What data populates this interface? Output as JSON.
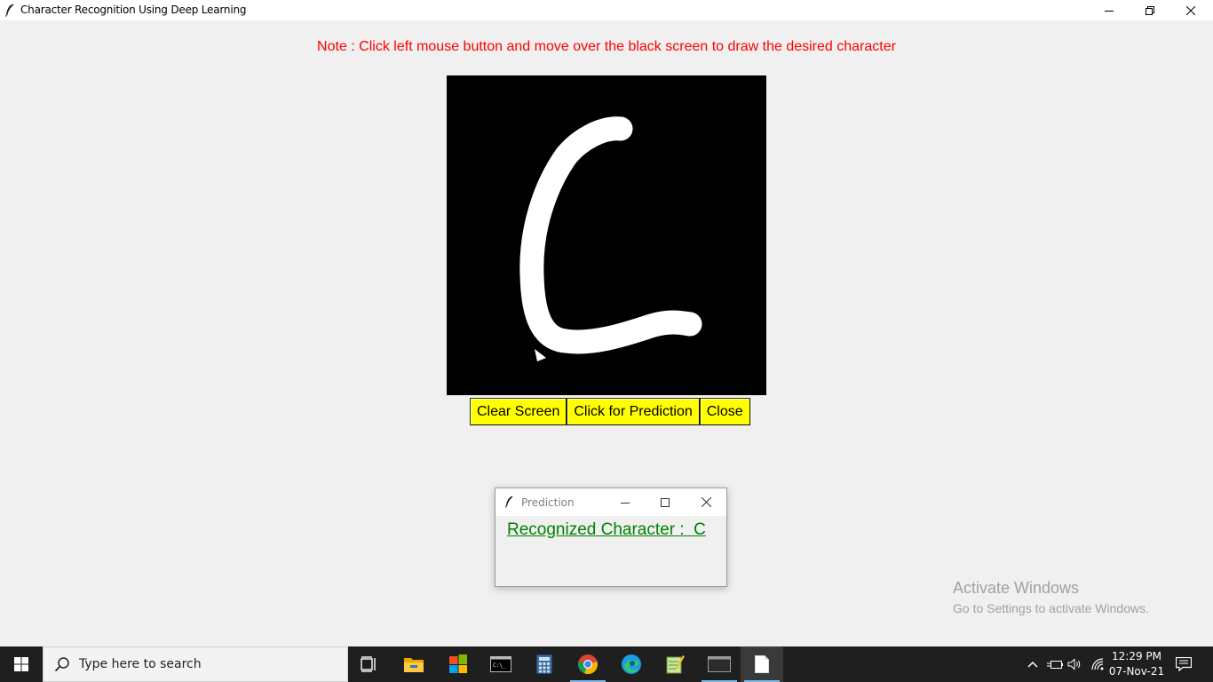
{
  "window": {
    "title": "Character Recognition Using Deep Learning"
  },
  "note": "Note : Click left mouse button and move over the black screen to draw the desired character",
  "buttons": {
    "clear": "Clear Screen",
    "predict": "Click for Prediction",
    "close": "Close"
  },
  "prediction_dialog": {
    "title": "Prediction",
    "result": "Recognized Character :  C"
  },
  "watermark": {
    "line1": "Activate Windows",
    "line2": "Go to Settings to activate Windows."
  },
  "taskbar": {
    "search_placeholder": "Type here to search",
    "apps": [
      "task-view",
      "file-explorer",
      "microsoft-store",
      "command-prompt",
      "calculator",
      "chrome",
      "edge",
      "notepad-plus-plus",
      "terminal",
      "notepad"
    ],
    "clock_time": "12:29 PM",
    "clock_date": "07-Nov-21"
  },
  "colors": {
    "note": "#ff0000",
    "button_bg": "#ffff00",
    "result_text": "#008000",
    "canvas_bg": "#000000",
    "stroke": "#ffffff"
  }
}
